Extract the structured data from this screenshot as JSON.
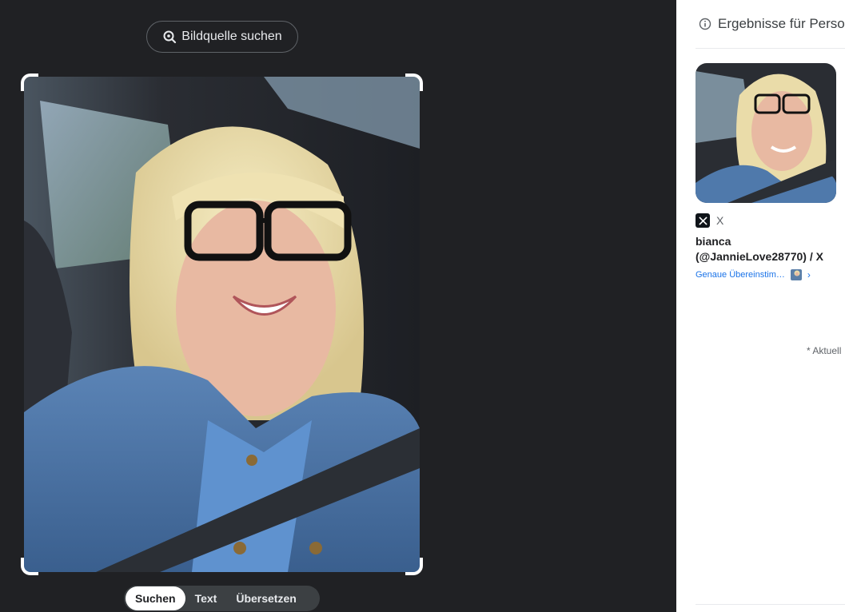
{
  "source_search": {
    "label": "Bildquelle suchen",
    "icon": "lens-search-icon"
  },
  "image_viewer": {
    "crop_handles": 4
  },
  "mode_tabs": [
    {
      "label": "Suchen",
      "active": true
    },
    {
      "label": "Text",
      "active": false
    },
    {
      "label": "Übersetzen",
      "active": false
    }
  ],
  "results": {
    "header": "Ergebnisse für Perso",
    "header_icon": "info-icon",
    "items": [
      {
        "source_icon": "x-logo-icon",
        "source": "X",
        "title": "bianca (@JannieLove28770) / X",
        "match_label": "Genaue Übereinstim…"
      }
    ],
    "footnote": "* Aktuell"
  },
  "colors": {
    "dark_bg": "#202124",
    "link_blue": "#1a73e8",
    "tab_track": "#3c4043"
  }
}
